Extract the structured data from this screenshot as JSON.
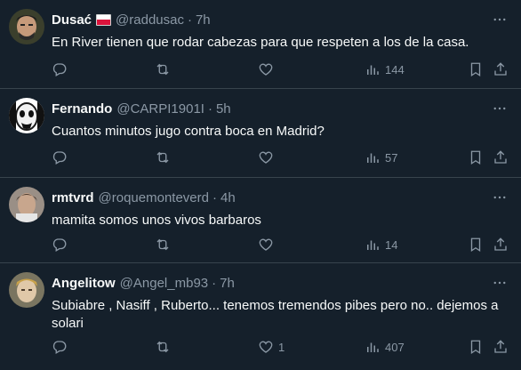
{
  "tweets": [
    {
      "name": "Dusać",
      "flag": "poland-flag",
      "handle": "@raddusac",
      "time": "7h",
      "text": "En River tienen que rodar cabezas para que respeten a los de la casa.",
      "likes": "",
      "views": "144"
    },
    {
      "name": "Fernando",
      "handle": "@CARPI1901I",
      "time": "5h",
      "text": "Cuantos minutos jugo contra boca en Madrid?",
      "likes": "",
      "views": "57"
    },
    {
      "name": "rmtvrd",
      "handle": "@roquemonteverd",
      "time": "4h",
      "text": "mamita somos unos vivos barbaros",
      "likes": "",
      "views": "14"
    },
    {
      "name": "Angelitow",
      "handle": "@Angel_mb93",
      "time": "7h",
      "text": "Subiabre , Nasiff , Ruberto... tenemos tremendos pibes pero no.. dejemos a solari",
      "likes": "1",
      "views": "407"
    }
  ],
  "separator": "·",
  "colors": {
    "background": "#15202b",
    "text": "#f7f9f9",
    "muted": "#8b98a5",
    "divider": "#38444d"
  }
}
